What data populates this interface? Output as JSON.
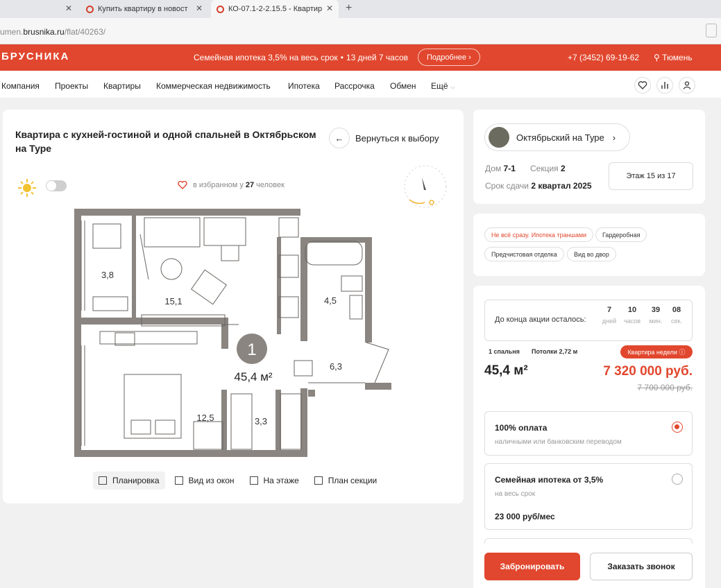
{
  "browser": {
    "tabs": [
      {
        "label": ""
      },
      {
        "label": "Купить квартиру в новост"
      },
      {
        "label": "КО-07.1-2-2.15.5 - Квартир"
      }
    ],
    "url_prefix": "umen.",
    "url_domain": "brusnika.ru",
    "url_path": "/flat/40263/"
  },
  "brandbar": {
    "logo": "БРУСНИКА",
    "promo": "Семейная ипотека 3,5% на весь срок",
    "promo_timer": "13 дней 7 часов",
    "promo_button": "Подробнее",
    "phone": "+7 (3452) 69-19-62",
    "city": "Тюмень"
  },
  "nav": {
    "items": [
      "Компания",
      "Проекты",
      "Квартиры",
      "Коммерческая недвижимость",
      "Ипотека",
      "Рассрочка",
      "Обмен",
      "Ещё"
    ]
  },
  "flat": {
    "title": "Квартира с кухней-гостиной и одной спальней в Октябрьском на Туре",
    "back_label": "Вернуться к выбору",
    "favorites_prefix": "в избранном у",
    "favorites_count": "27",
    "favorites_suffix": "человек",
    "rooms_badge": "1",
    "total_area": "45,4 м²",
    "rooms": [
      {
        "area": "3,8"
      },
      {
        "area": "15,1"
      },
      {
        "area": "4,5"
      },
      {
        "area": "6,3"
      },
      {
        "area": "12,5"
      },
      {
        "area": "3,3"
      }
    ],
    "view_tabs": [
      "Планировка",
      "Вид из окон",
      "На этаже",
      "План секции"
    ]
  },
  "project": {
    "name": "Октябрьский на Туре",
    "house_label": "Дом",
    "house": "7-1",
    "section_label": "Секция",
    "section": "2",
    "deadline_label": "Срок сдачи",
    "deadline": "2 квартал 2025",
    "floor": "Этаж 15 из 17"
  },
  "tags": [
    "Не всё сразу. Ипотека траншами",
    "Гардеробная",
    "Предчистовая отделка",
    "Вид во двор"
  ],
  "offer": {
    "timer_label": "До конца акции осталось:",
    "timer": [
      {
        "num": "7",
        "unit": "дней"
      },
      {
        "num": "10",
        "unit": "часов"
      },
      {
        "num": "39",
        "unit": "мин."
      },
      {
        "num": "08",
        "unit": "сек."
      }
    ],
    "bedrooms": "1 спальня",
    "ceilings": "Потолки 2,72 м",
    "badge": "Квартира недели",
    "area": "45,4 м²",
    "price": "7 320 000 руб.",
    "old_price": "7 700 000 руб.",
    "payments": [
      {
        "title": "100% оплата",
        "subtitle": "наличными или банковским переводом",
        "selected": true
      },
      {
        "title": "Семейная ипотека от 3,5%",
        "subtitle": "на весь срок",
        "amount": "23 000 руб/мес",
        "selected": false
      }
    ],
    "book_button": "Забронировать",
    "call_button": "Заказать звонок"
  },
  "colors": {
    "brand": "#e1472e",
    "wall": "#8a8580"
  }
}
